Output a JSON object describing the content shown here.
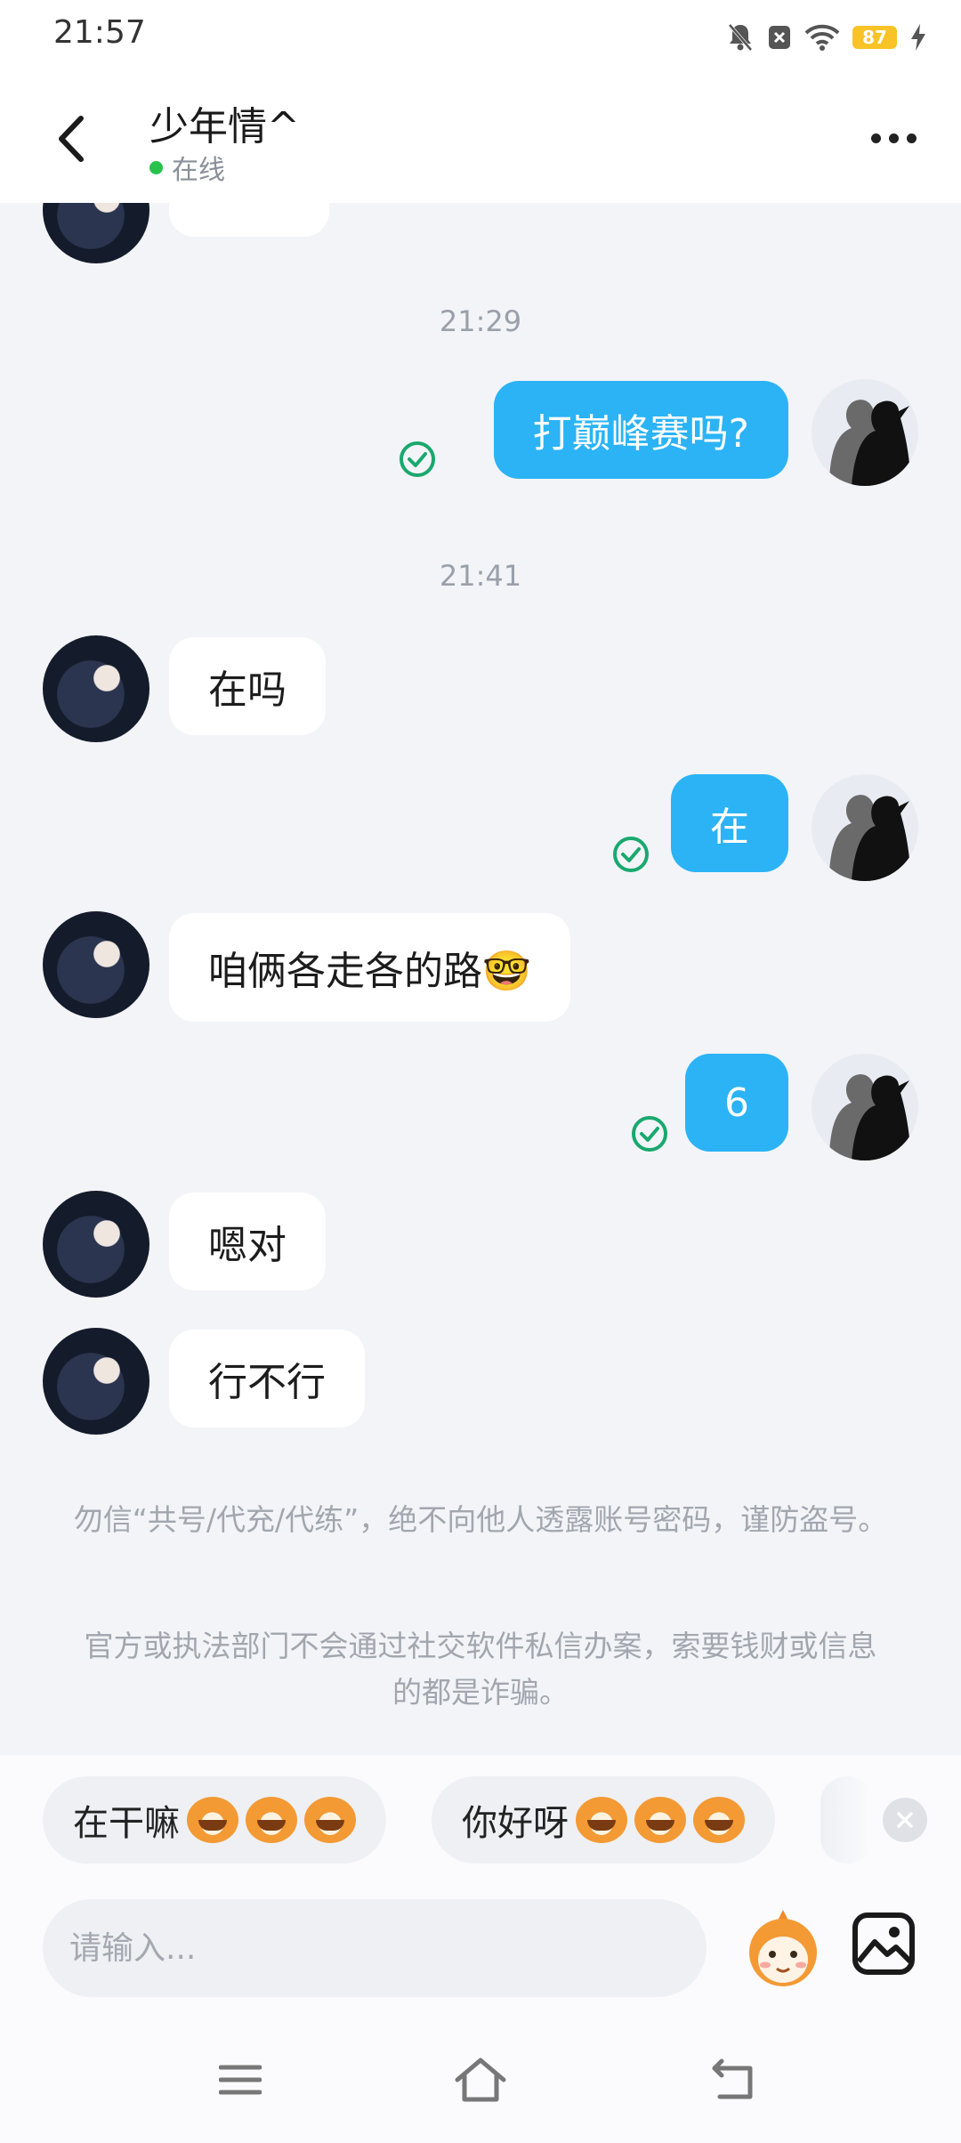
{
  "status_bar": {
    "time": "21:57",
    "battery": "87",
    "icons": [
      "mute-bell-icon",
      "close-box-icon",
      "wifi-icon",
      "battery-icon",
      "charging-bolt-icon"
    ]
  },
  "header": {
    "title": "少年情^",
    "presence": "在线",
    "presence_color": "#27c24c"
  },
  "messages": [
    {
      "type": "timestamp",
      "text": "21:29"
    },
    {
      "type": "outgoing",
      "text": "打巅峰赛吗?",
      "read": true
    },
    {
      "type": "timestamp",
      "text": "21:41"
    },
    {
      "type": "incoming",
      "text": "在吗"
    },
    {
      "type": "outgoing",
      "text": "在",
      "read": true
    },
    {
      "type": "incoming",
      "text": "咱俩各走各的路🤓"
    },
    {
      "type": "outgoing",
      "text": "6",
      "read": true
    },
    {
      "type": "incoming",
      "text": "嗯对"
    },
    {
      "type": "incoming",
      "text": "行不行"
    }
  ],
  "notices": [
    "勿信“共号/代充/代练”，绝不向他人透露账号密码，谨防盗号。",
    "官方或执法部门不会通过社交软件私信办案，索要钱财或信息的都是诈骗。"
  ],
  "quick_replies": [
    {
      "text": "在干嘛",
      "emoji_count": 3
    },
    {
      "text": "你好呀",
      "emoji_count": 3
    }
  ],
  "input": {
    "placeholder": "请输入..."
  },
  "colors": {
    "outgoing_bubble": "#2bb3f5",
    "incoming_bubble": "#ffffff",
    "background": "#f2f4f8",
    "read_check": "#1aa86e"
  }
}
